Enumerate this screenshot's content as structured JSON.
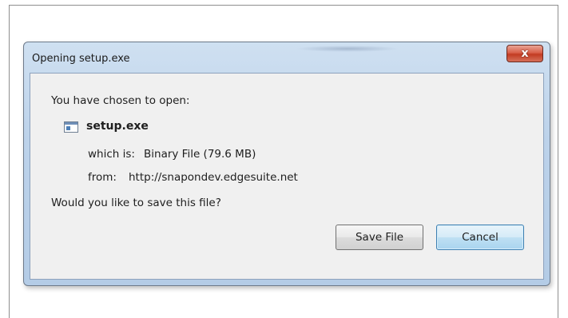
{
  "dialog": {
    "title": "Opening setup.exe",
    "close_glyph": "x",
    "intro": "You have chosen to open:",
    "file": {
      "name": "setup.exe",
      "icon": "application-window-icon"
    },
    "which_is_label": "which is:",
    "which_is_value": "Binary File (79.6 MB)",
    "from_label": "from:",
    "from_value": "http://snapondev.edgesuite.net",
    "question": "Would you like to save this file?",
    "buttons": {
      "save": "Save File",
      "cancel": "Cancel"
    }
  },
  "colors": {
    "title_bar": "#bcd2ea",
    "close_button": "#c23b22",
    "client_area": "#f0f0f0",
    "default_button_border": "#3c7fb1"
  }
}
